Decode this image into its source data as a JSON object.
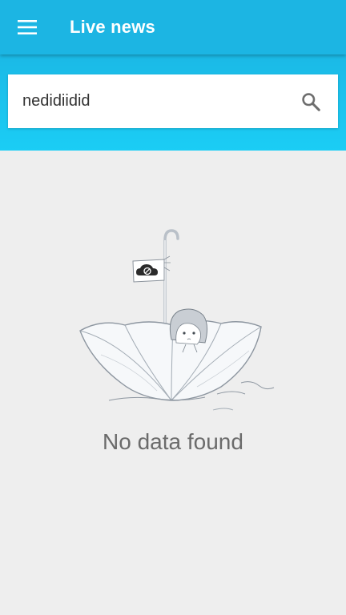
{
  "app_bar": {
    "title": "Live news",
    "menu_icon": "hamburger-menu-icon"
  },
  "search": {
    "value": "nedidiidid",
    "search_icon": "search-icon"
  },
  "empty_state": {
    "message": "No data found",
    "illustration": "girl-in-umbrella-boat-illustration",
    "flag_icon": "cloud-blocked-icon"
  },
  "colors": {
    "app_bar": "#1cb5e3",
    "search_band_top": "#1bb9e6",
    "search_band_bottom": "#1bcdf5",
    "background": "#eeeeee",
    "message_text": "#6b6b6b"
  }
}
